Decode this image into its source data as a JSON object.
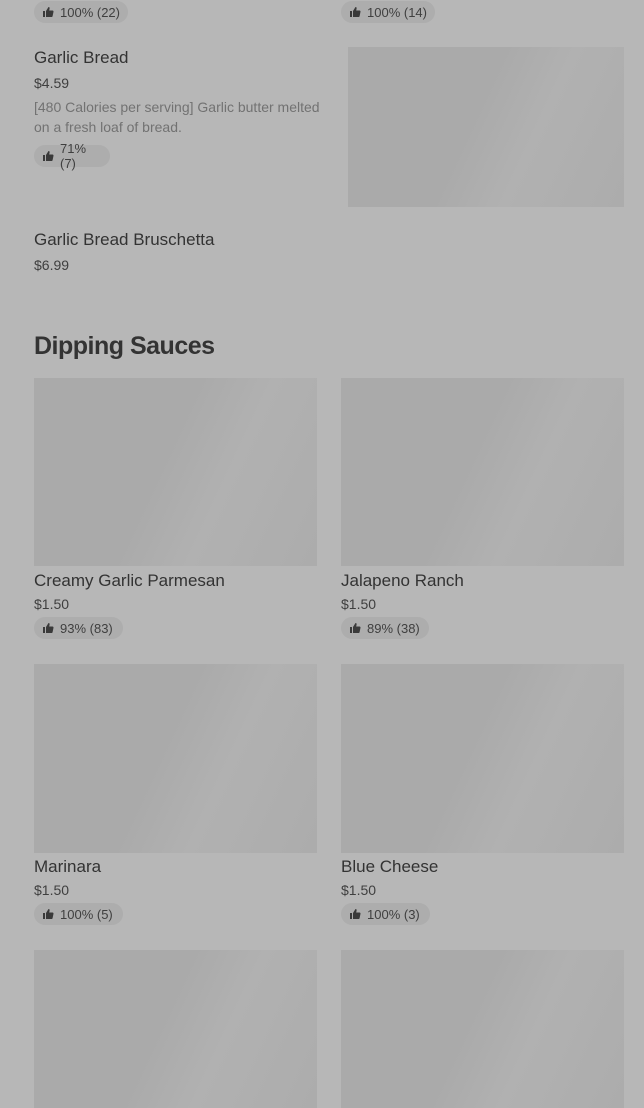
{
  "top_badges": [
    {
      "rating": "100% (22)"
    },
    {
      "rating": "100% (14)"
    }
  ],
  "items": [
    {
      "name": "Garlic Bread",
      "price": "$4.59",
      "description": "[480 Calories per serving] Garlic butter melted on a fresh loaf of bread.",
      "rating": "71% (7)"
    },
    {
      "name": "Garlic Bread Bruschetta",
      "price": "$6.99"
    }
  ],
  "section": {
    "title": "Dipping Sauces"
  },
  "sauces": [
    {
      "name": "Creamy Garlic Parmesan",
      "price": "$1.50",
      "rating": "93% (83)"
    },
    {
      "name": "Jalapeno Ranch",
      "price": "$1.50",
      "rating": "89% (38)"
    },
    {
      "name": "Marinara",
      "price": "$1.50",
      "rating": "100% (5)"
    },
    {
      "name": "Blue Cheese",
      "price": "$1.50",
      "rating": "100% (3)"
    }
  ],
  "icons": {
    "rating": "thumbs-up-icon"
  },
  "colors": {
    "background": "#b7b7b7",
    "placeholder": "#aaaaaa",
    "badge": "#adadad"
  }
}
